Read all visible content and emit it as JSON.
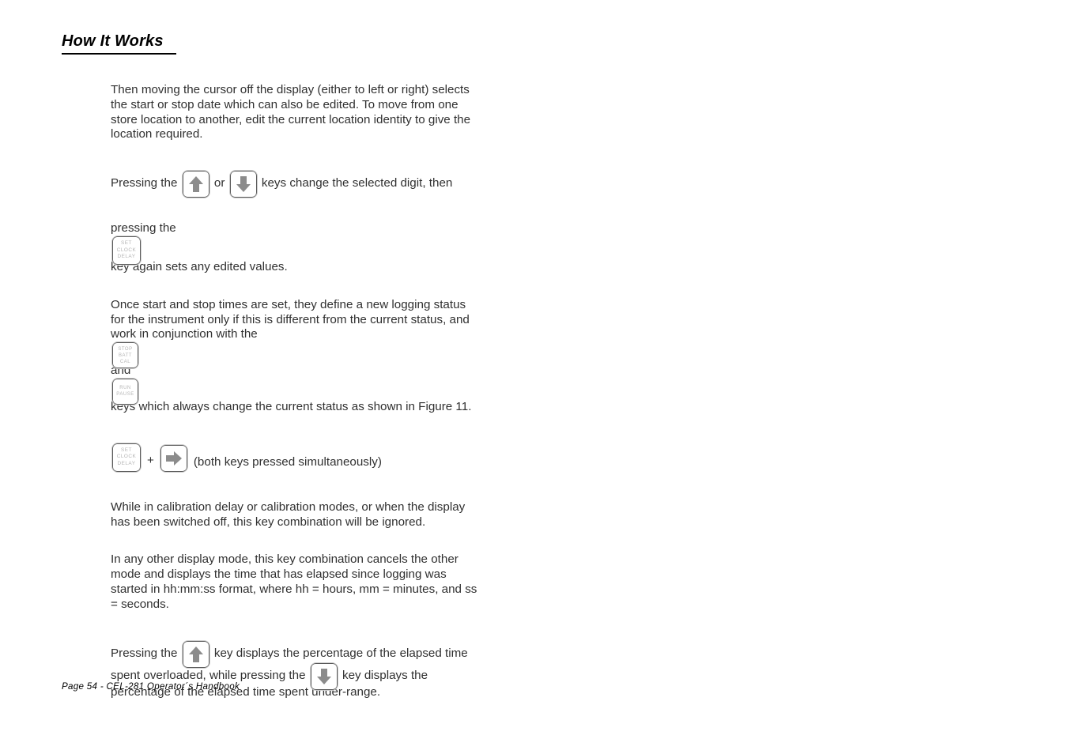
{
  "document": {
    "heading": "How It Works ",
    "footer": "Page 54 - CEL-281 Operator´s Handbook"
  },
  "keys": {
    "up": {
      "icon": "arrow-up-key",
      "label": ""
    },
    "down": {
      "icon": "arrow-down-key",
      "label": ""
    },
    "right": {
      "icon": "arrow-right-key",
      "label": ""
    },
    "set_clock_delay": {
      "icon": "set-clock-delay-key",
      "line1": "SET",
      "line2": "CLOCK",
      "line3": "DELAY"
    },
    "stop_batt_cal": {
      "icon": "stop-batt-cal-key",
      "line1": "STOP",
      "line2": "BATT",
      "line3": "CAL"
    },
    "run_pause": {
      "icon": "run-pause-key",
      "line1": "RUN",
      "line2": "PAUSE"
    }
  },
  "body": {
    "para1": "Then moving the cursor off the display (either to left or right) selects the start or stop date which can also be edited. To move from one store location to another, edit the current location identity to give the location required.",
    "para2_a": "Pressing the",
    "para2_b": "or",
    "para2_c": "keys change the selected digit, then",
    "para3_a": "pressing the",
    "para3_b": "key again sets any edited values.",
    "para4_a": "Once start and stop times are set, they define a new logging status for the instrument only if this is different from the current status, and work in conjunction with the",
    "para4_b": "and",
    "para4_c": "keys which always change the current status as shown in Figure 11.",
    "combo_plus": "+",
    "combo_caption": "(both keys pressed simultaneously)",
    "para5": "While in calibration delay or calibration modes, or when the display has been switched off, this key combination will be ignored.",
    "para6": "In any other display mode, this key combination cancels the other mode and displays the time that has elapsed since logging was started in hh:mm:ss format, where hh = hours, mm = minutes, and ss = seconds.",
    "para7_a": "Pressing the",
    "para7_b": "key displays the percentage of the elapsed time spent overloaded, while pressing the",
    "para7_c": "key displays the percentage of the elapsed time spent under-range."
  },
  "colors": {
    "text": "#303030",
    "heading": "#000000",
    "key_border": "#5a5a5a",
    "key_glyph": "#8c8c8c",
    "key_label": "#b5b5b5"
  }
}
